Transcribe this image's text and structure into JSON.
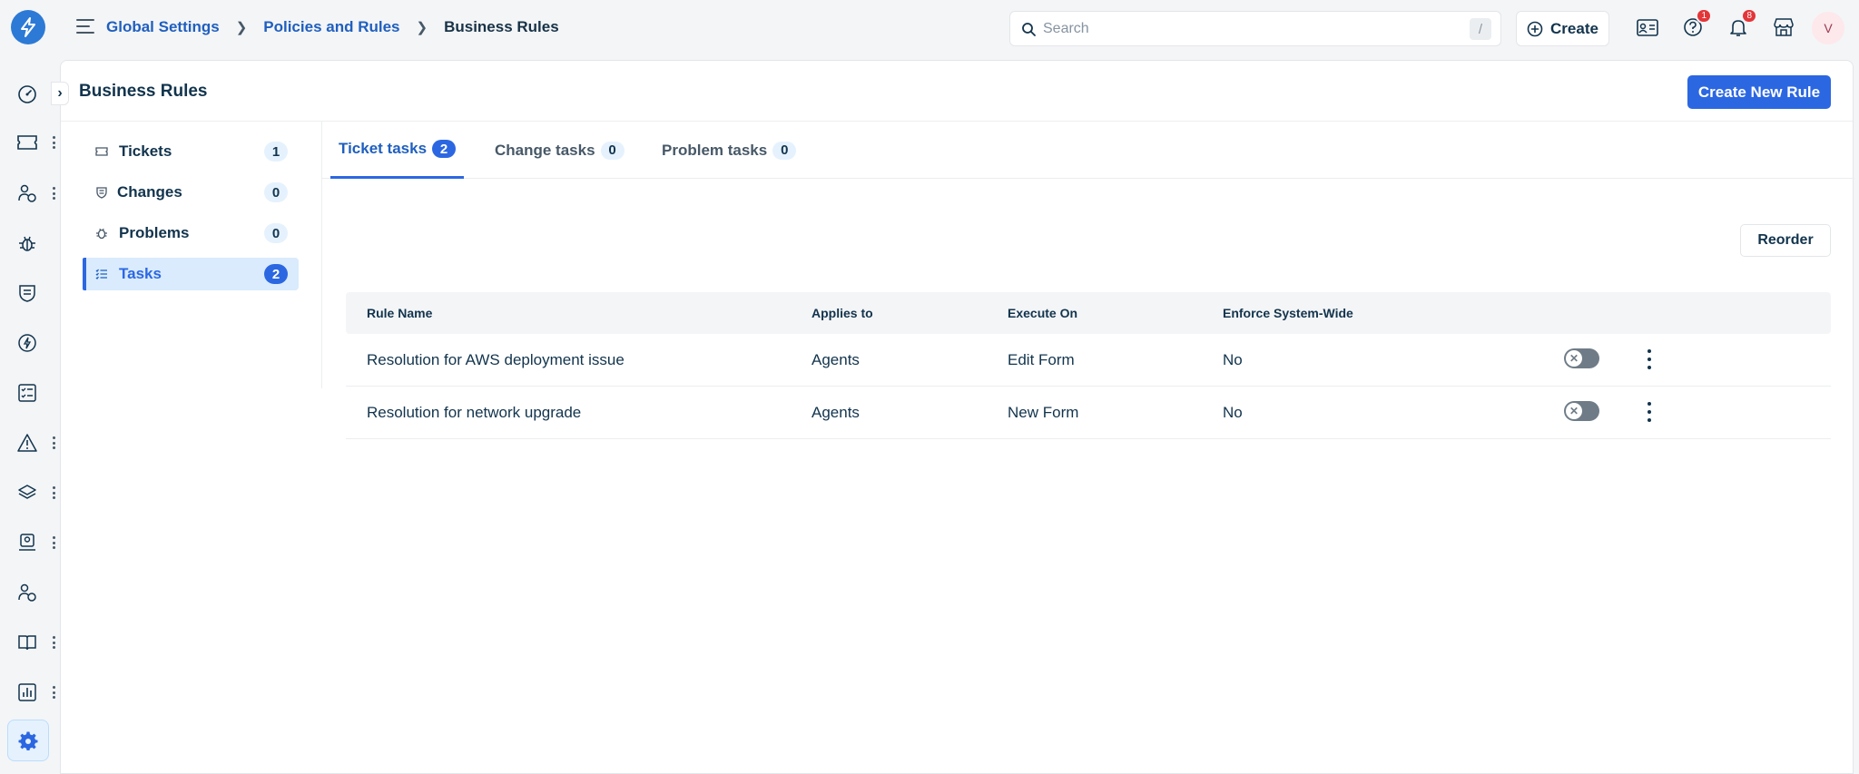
{
  "breadcrumb": {
    "global_settings": "Global Settings",
    "policies": "Policies and Rules",
    "current": "Business Rules"
  },
  "search": {
    "placeholder": "Search",
    "shortcut": "/"
  },
  "topbar": {
    "create_label": "Create",
    "help_badge": "1",
    "notifications_badge": "8",
    "avatar_initial": "V"
  },
  "page": {
    "title": "Business Rules",
    "create_rule_label": "Create New Rule",
    "reorder_label": "Reorder"
  },
  "modules": [
    {
      "label": "Tickets",
      "count": "1",
      "icon": "ticket-icon"
    },
    {
      "label": "Changes",
      "count": "0",
      "icon": "change-icon"
    },
    {
      "label": "Problems",
      "count": "0",
      "icon": "bug-icon"
    },
    {
      "label": "Tasks",
      "count": "2",
      "icon": "task-list-icon",
      "active": true
    }
  ],
  "tabs": [
    {
      "label": "Ticket tasks",
      "count": "2",
      "active": true
    },
    {
      "label": "Change tasks",
      "count": "0"
    },
    {
      "label": "Problem tasks",
      "count": "0"
    }
  ],
  "table": {
    "headers": [
      "Rule Name",
      "Applies to",
      "Execute On",
      "Enforce System-Wide"
    ],
    "rows": [
      {
        "name": "Resolution for AWS deployment issue",
        "applies_to": "Agents",
        "execute_on": "Edit Form",
        "enforce": "No",
        "enabled": false
      },
      {
        "name": "Resolution for network upgrade",
        "applies_to": "Agents",
        "execute_on": "New Form",
        "enforce": "No",
        "enabled": false
      }
    ]
  },
  "colors": {
    "accent": "#2c67e2",
    "link": "#1f5fbf",
    "badge_red": "#e43538",
    "toggle_off": "#6f7c87"
  }
}
